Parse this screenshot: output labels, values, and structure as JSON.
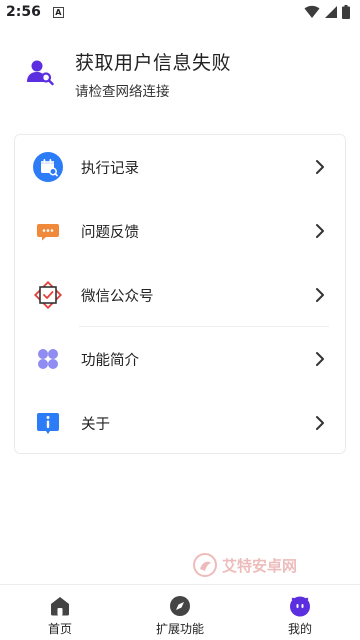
{
  "status_bar": {
    "time": "2:56",
    "notification_glyph": "A"
  },
  "profile": {
    "title": "获取用户信息失败",
    "subtitle": "请检查网络连接"
  },
  "menu": {
    "items": [
      {
        "label": "执行记录",
        "icon": "calendar-search-icon"
      },
      {
        "label": "问题反馈",
        "icon": "chat-bubble-icon"
      },
      {
        "label": "微信公众号",
        "icon": "wechat-official-icon"
      },
      {
        "label": "功能简介",
        "icon": "four-circles-icon"
      },
      {
        "label": "关于",
        "icon": "info-icon"
      }
    ]
  },
  "watermark": {
    "text": "艾特安卓网"
  },
  "bottom_nav": {
    "items": [
      {
        "label": "首页",
        "icon": "home-icon"
      },
      {
        "label": "扩展功能",
        "icon": "compass-icon"
      },
      {
        "label": "我的",
        "icon": "profile-face-icon"
      }
    ]
  },
  "colors": {
    "accent_purple": "#5b2ee0",
    "blue": "#2b7cf6",
    "orange": "#f08a3a",
    "red": "#e0413a",
    "light_purple": "#8f8cf2",
    "nav_gray": "#444444"
  }
}
